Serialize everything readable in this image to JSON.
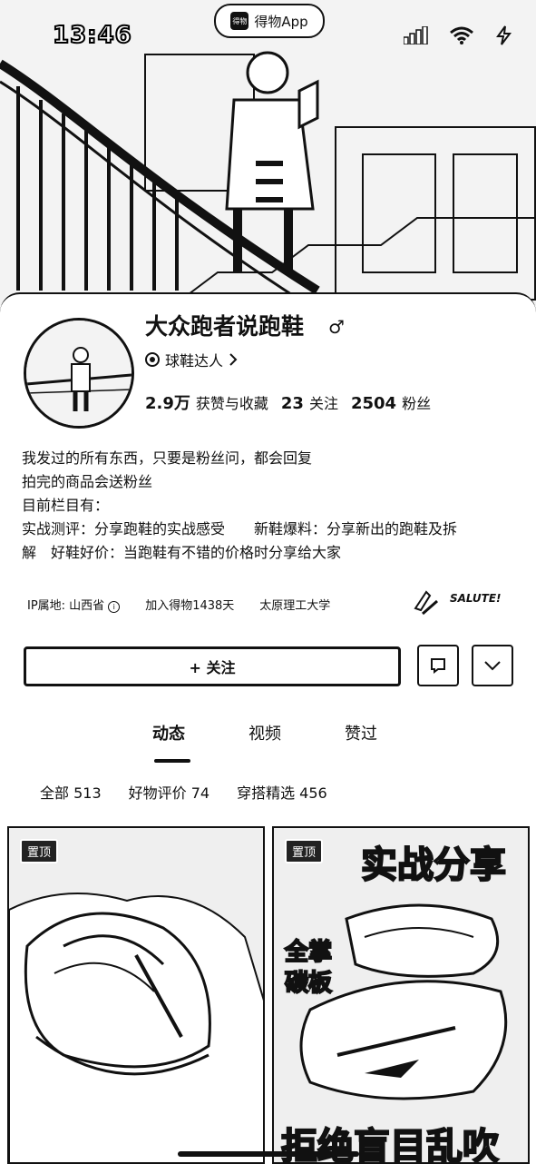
{
  "status_bar": {
    "time": "13:46",
    "app_name": "得物App",
    "app_logo_text": "得物",
    "icons": [
      "signal-icon",
      "wifi-icon",
      "battery-charging-icon"
    ]
  },
  "profile": {
    "nickname": "大众跑者说跑鞋",
    "gender_symbol": "♂",
    "badge_label": "球鞋达人",
    "stats": [
      {
        "value": "2.9万",
        "label": "获赞与收藏"
      },
      {
        "value": "23",
        "label": "关注"
      },
      {
        "value": "2504",
        "label": "粉丝"
      }
    ],
    "bio_lines": [
      "我发过的所有东西，只要是粉丝问，都会回复",
      "拍完的商品会送粉丝",
      "目前栏目有：",
      "实战测评：分享跑鞋的实战感受　　新鞋爆料：分享新出的跑鞋及拆",
      "解　好鞋好价：当跑鞋有不错的价格时分享给大家"
    ],
    "ip_location": "IP属地: 山西省",
    "joined": "加入得物1438天",
    "school": "太原理工大学",
    "salute_text": "SALUTE!"
  },
  "actions": {
    "follow_label": "+ 关注"
  },
  "tabs": [
    {
      "label": "动态",
      "active": true
    },
    {
      "label": "视频",
      "active": false
    },
    {
      "label": "赞过",
      "active": false
    }
  ],
  "subtabs": [
    "全部 513",
    "好物评价 74",
    "穿搭精选 456"
  ],
  "posts": [
    {
      "pin_label": "置顶"
    },
    {
      "pin_label": "置顶",
      "title_top": "实战分享",
      "side_text_1": "全掌",
      "side_text_2": "碳板",
      "title_bottom": "拒绝盲目乱吹"
    }
  ]
}
